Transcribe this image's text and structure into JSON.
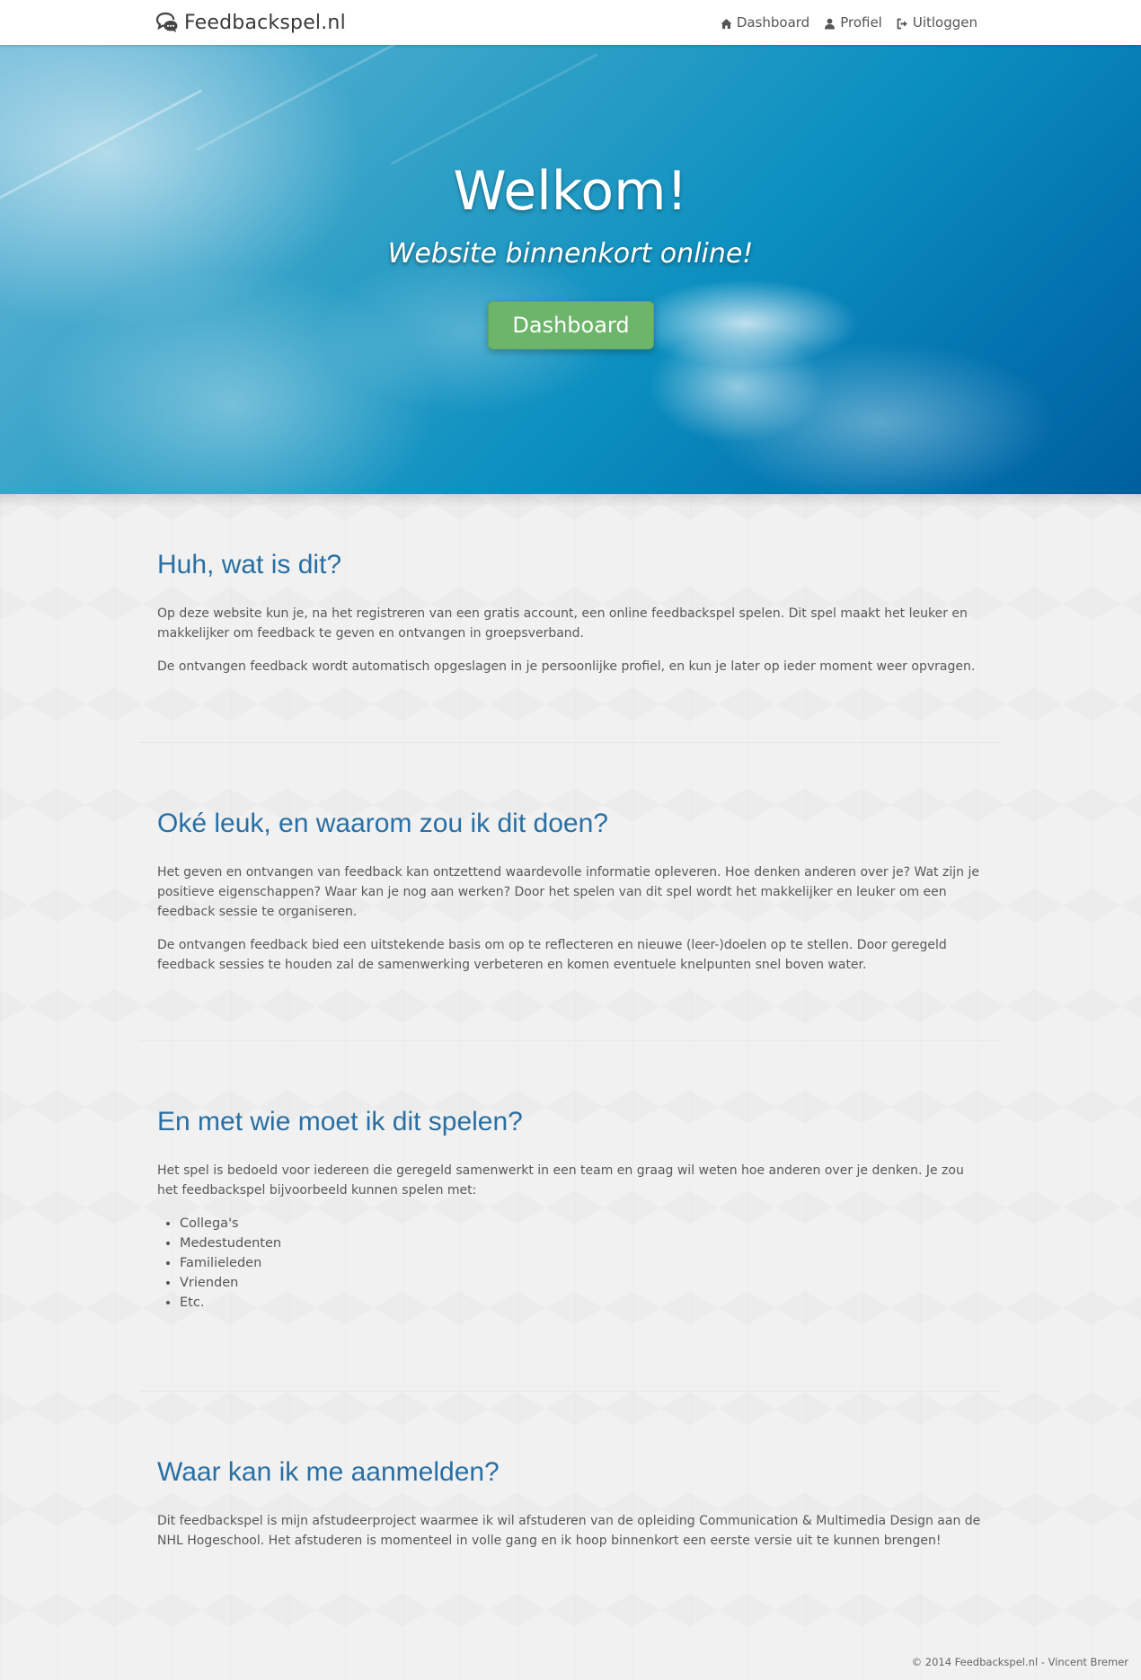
{
  "navbar": {
    "brand": "Feedbackspel.nl",
    "brand_icon": "chat-bubbles-icon",
    "links": [
      {
        "label": "Dashboard",
        "icon": "home-icon"
      },
      {
        "label": "Profiel",
        "icon": "user-icon"
      },
      {
        "label": "Uitloggen",
        "icon": "sign-out-icon"
      }
    ]
  },
  "hero": {
    "title": "Welkom!",
    "subtitle": "Website binnenkort online!",
    "button_label": "Dashboard"
  },
  "sections": [
    {
      "heading": "Huh, wat is dit?",
      "paragraphs": [
        "Op deze website kun je, na het registreren van een gratis account, een online feedbackspel spelen. Dit spel maakt het leuker en makkelijker om feedback te geven en ontvangen in groepsverband.",
        "De ontvangen feedback wordt automatisch opgeslagen in je persoonlijke profiel, en kun je later op ieder moment weer opvragen."
      ]
    },
    {
      "heading": "Oké leuk, en waarom zou ik dit doen?",
      "paragraphs": [
        "Het geven en ontvangen van feedback kan ontzettend waardevolle informatie opleveren. Hoe denken anderen over je? Wat zijn je positieve eigenschappen? Waar kan je nog aan werken? Door het spelen van dit spel wordt het makkelijker en leuker om een feedback sessie te organiseren.",
        "De ontvangen feedback bied een uitstekende basis om op te reflecteren en nieuwe (leer-)doelen op te stellen. Door geregeld feedback sessies te houden zal de samenwerking verbeteren en komen eventuele knelpunten snel boven water."
      ]
    },
    {
      "heading": "En met wie moet ik dit spelen?",
      "paragraphs": [
        "Het spel is bedoeld voor iedereen die geregeld samenwerkt in een team en graag wil weten hoe anderen over je denken. Je zou het feedbackspel bijvoorbeeld kunnen spelen met:"
      ],
      "list": [
        "Collega's",
        "Medestudenten",
        "Familieleden",
        "Vrienden",
        "Etc."
      ]
    },
    {
      "heading": "Waar kan ik me aanmelden?",
      "paragraphs": [
        "Dit feedbackspel is mijn afstudeerproject waarmee ik wil afstuderen van de opleiding Communication & Multimedia Design aan de NHL Hogeschool. Het afstuderen is momenteel in volle gang en ik hoop binnenkort een eerste versie uit te kunnen brengen!"
      ]
    }
  ],
  "footer": {
    "text": "© 2014 Feedbackspel.nl - Vincent Bremer"
  },
  "colors": {
    "heading": "#2a6fa3",
    "button": "#6cb56a",
    "sky": "#0b8fc0"
  }
}
